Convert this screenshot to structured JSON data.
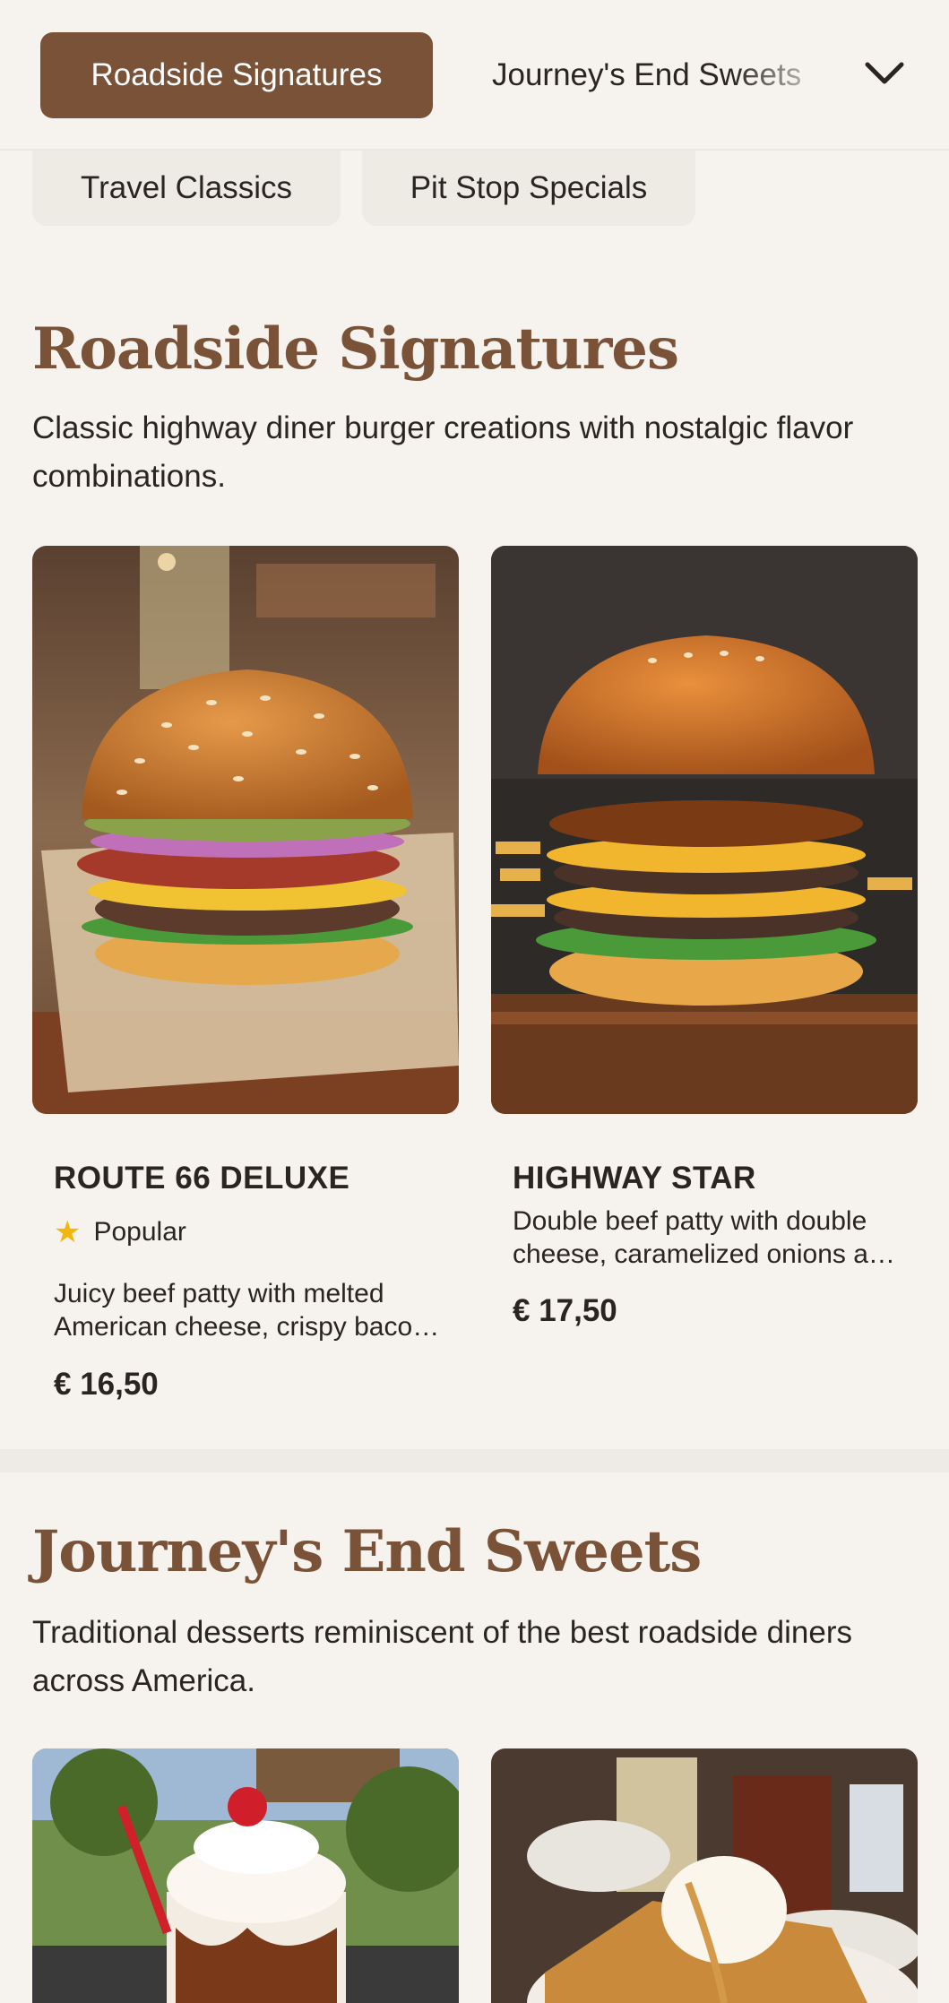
{
  "nav": {
    "active_category": "Roadside Signatures",
    "next_category": "Journey's End Sweets",
    "chips": [
      "Travel Classics",
      "Pit Stop Specials"
    ]
  },
  "sections": [
    {
      "title": "Roadside Signatures",
      "description": "Classic highway diner burger creations with nostalgic flavor combinations.",
      "items": [
        {
          "name": "ROUTE 66 DELUXE",
          "badge": "Popular",
          "description": "Juicy beef patty with melted American cheese, crispy bacon, grilled onions and pickles.",
          "price": "€ 16,50"
        },
        {
          "name": "HIGHWAY STAR",
          "description": "Double beef patty with double cheese, caramelized onions and smoky sauce.",
          "price": "€ 17,50"
        }
      ]
    },
    {
      "title": "Journey's End Sweets",
      "description": "Traditional desserts reminiscent of the best roadside diners across America."
    }
  ],
  "colors": {
    "accent": "#7a5237",
    "background": "#f6f3ee",
    "chip": "#eeeae4",
    "star": "#f2b70f"
  },
  "icons": {
    "chevron": "chevron-down-icon",
    "star": "star-icon"
  }
}
